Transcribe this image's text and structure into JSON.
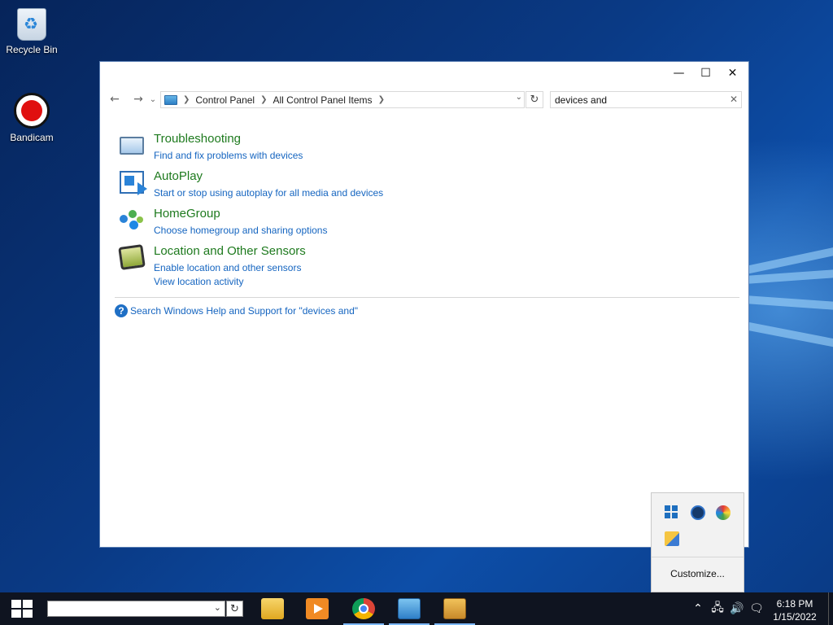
{
  "desktop": {
    "icons": [
      {
        "label": "Recycle Bin",
        "icon": "recycle-bin-icon"
      },
      {
        "label": "Bandicam",
        "icon": "bandicam-icon"
      }
    ]
  },
  "window": {
    "controls": {
      "minimize": "—",
      "maximize": "☐",
      "close": "✕"
    },
    "nav": {
      "back": "←",
      "forward": "→",
      "recent": "⌄"
    },
    "breadcrumbs": [
      "Control Panel",
      "All Control Panel Items"
    ],
    "search": {
      "value": "devices and"
    },
    "results": [
      {
        "title": "Troubleshooting",
        "icon": "troubleshooting-icon",
        "links": [
          "Find and fix problems with devices"
        ]
      },
      {
        "title": "AutoPlay",
        "icon": "autoplay-icon",
        "links": [
          "Start or stop using autoplay for all media and devices"
        ]
      },
      {
        "title": "HomeGroup",
        "icon": "homegroup-icon",
        "links": [
          "Choose homegroup and sharing options"
        ]
      },
      {
        "title": "Location and Other Sensors",
        "icon": "location-sensors-icon",
        "links": [
          "Enable location and other sensors",
          "View location activity"
        ]
      }
    ],
    "help_link": "Search Windows Help and Support for \"devices and\""
  },
  "tray_overflow": {
    "icons": [
      "tiles-icon",
      "shield-icon",
      "colorful-wheel-icon",
      "cleaner-icon"
    ],
    "customize_label": "Customize..."
  },
  "taskbar": {
    "apps": [
      {
        "name": "file-explorer",
        "color": "#f0c33c"
      },
      {
        "name": "media-player",
        "color": "#f08a24"
      },
      {
        "name": "chrome",
        "color": "#db4437"
      },
      {
        "name": "control-panel",
        "color": "#3a8fd6"
      },
      {
        "name": "program-installer",
        "color": "#d9a23a"
      }
    ],
    "clock": {
      "time": "6:18 PM",
      "date": "1/15/2022"
    }
  }
}
